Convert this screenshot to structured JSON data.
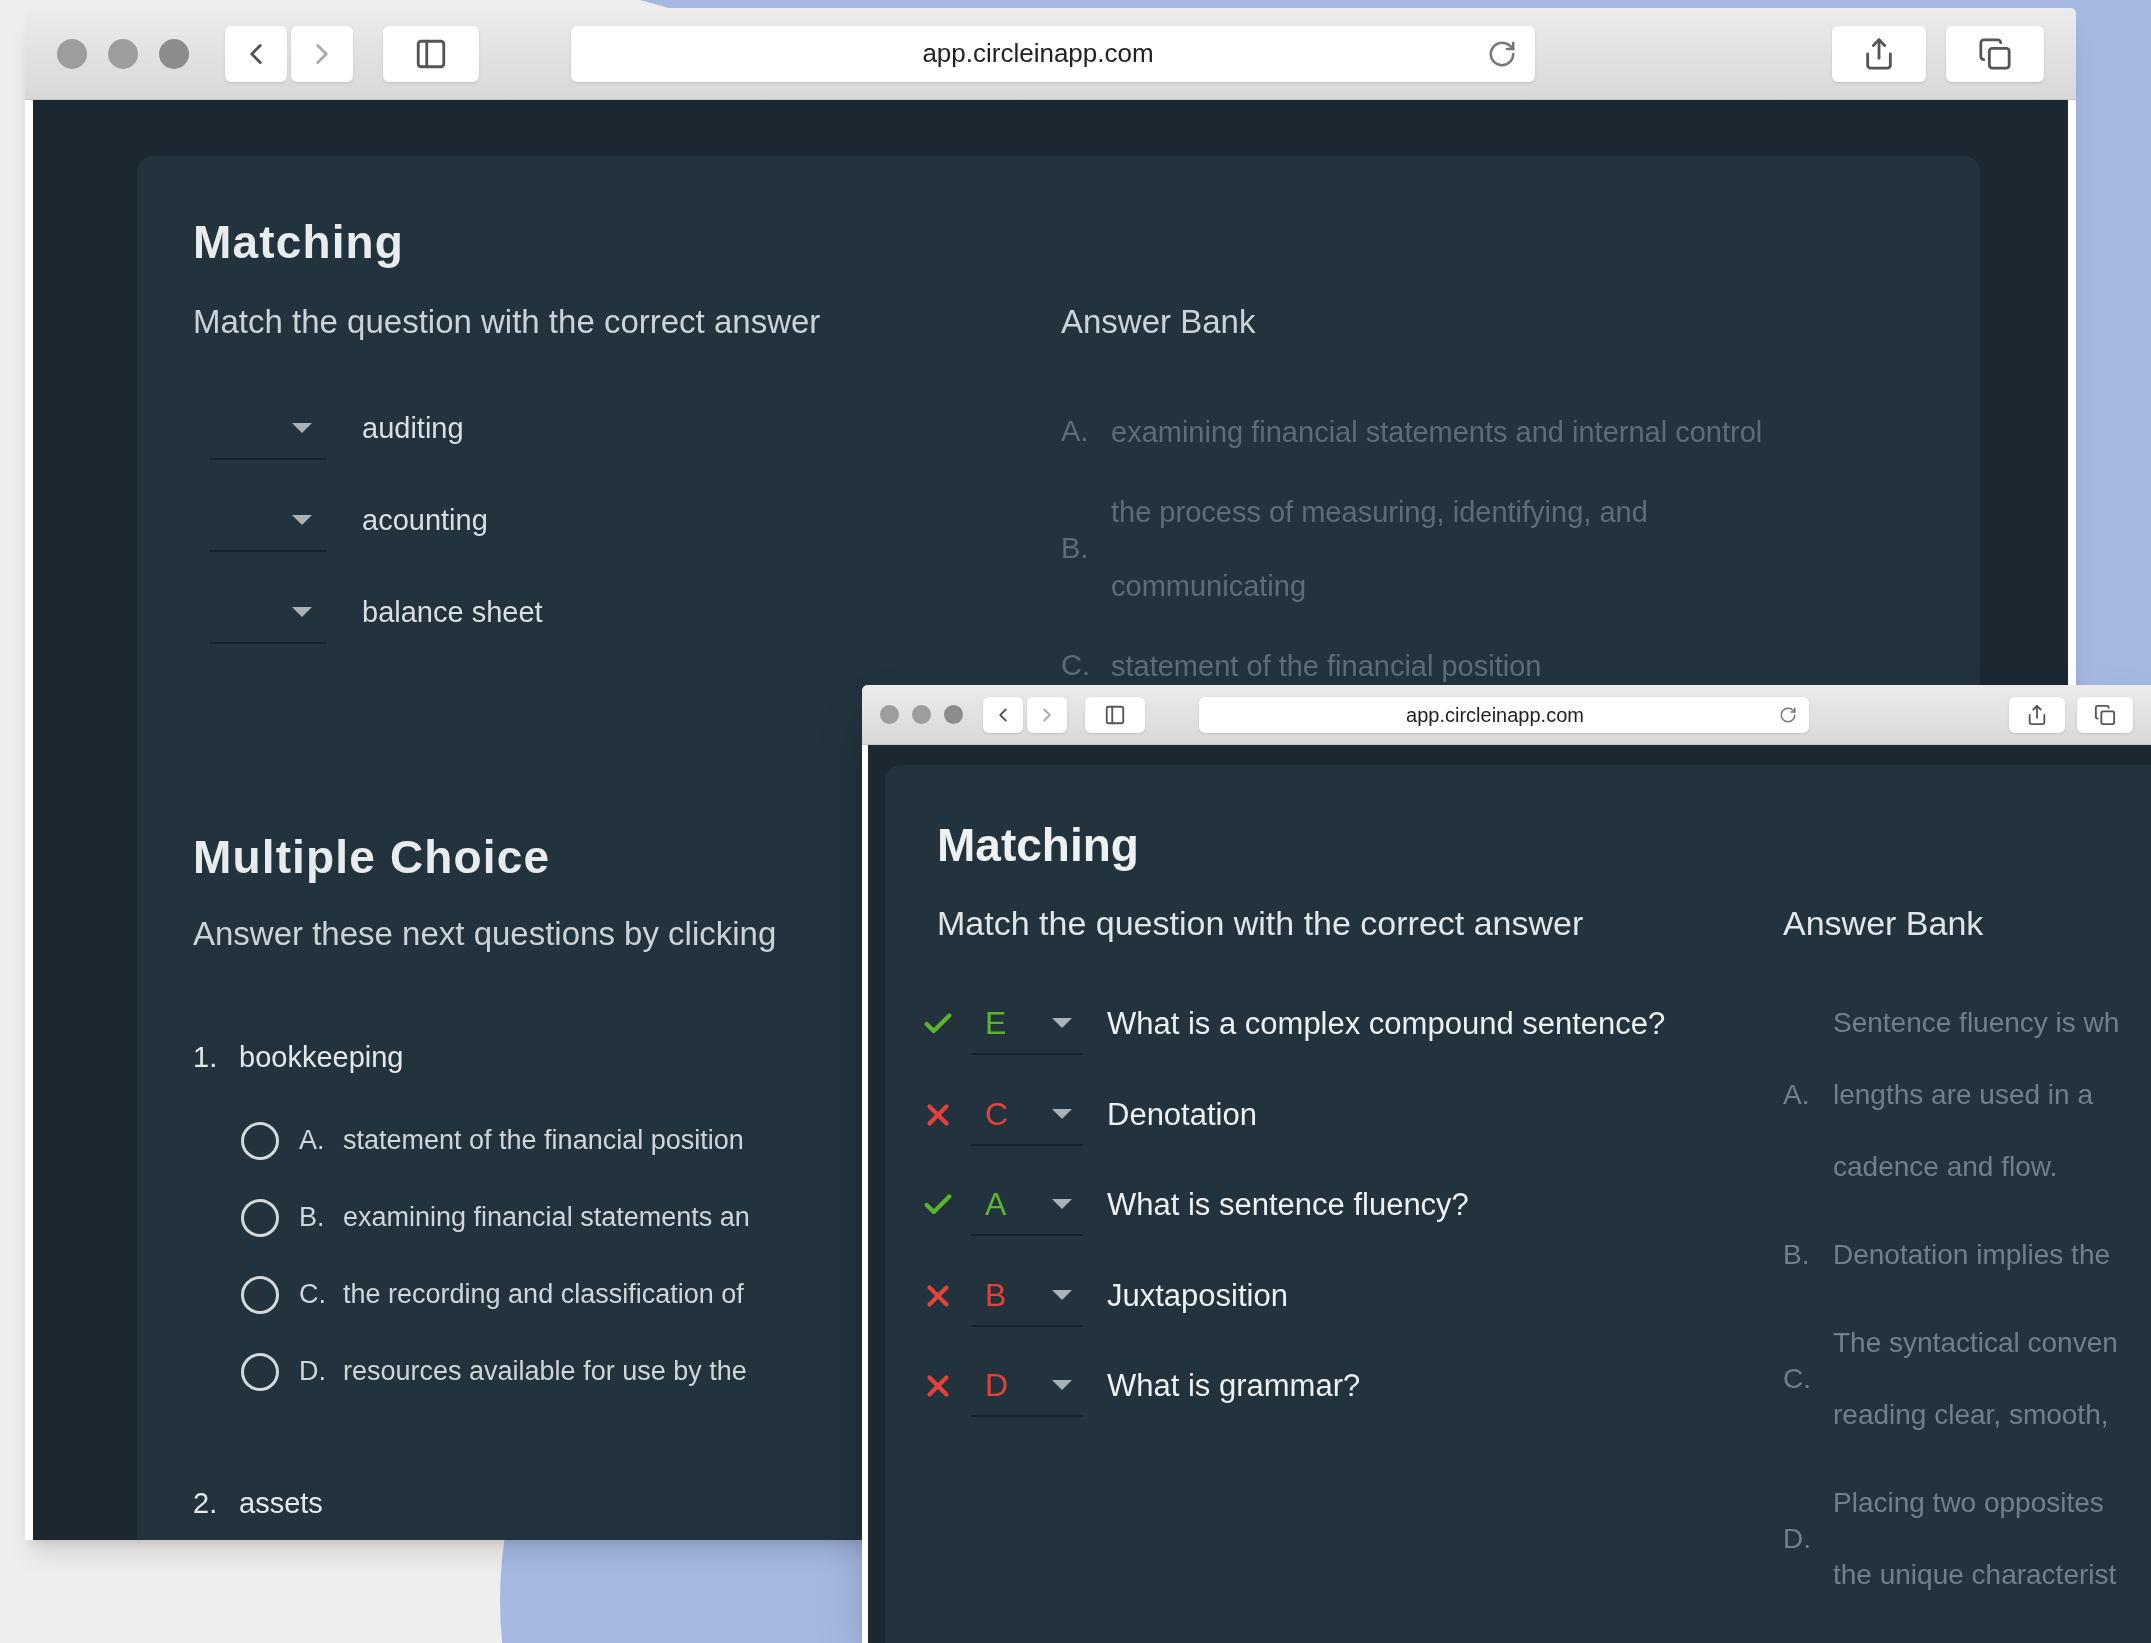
{
  "back_window": {
    "url": "app.circleinapp.com",
    "matching": {
      "title": "Matching",
      "instructions": "Match the question with the correct answer",
      "answer_bank_title": "Answer Bank",
      "questions": [
        {
          "text": "auditing"
        },
        {
          "text": "acounting"
        },
        {
          "text": "balance sheet"
        }
      ],
      "answer_bank": [
        {
          "letter": "A.",
          "lines": [
            "examining financial statements and internal control"
          ]
        },
        {
          "letter": "B.",
          "lines": [
            "the process of measuring, identifying, and",
            "communicating"
          ]
        },
        {
          "letter": "C.",
          "lines": [
            "statement of the financial position"
          ]
        }
      ]
    },
    "multiple_choice": {
      "title": "Multiple Choice",
      "instructions": "Answer these next questions by clicking",
      "questions": [
        {
          "number": "1.",
          "text": "bookkeeping",
          "options": [
            {
              "letter": "A.",
              "text": "statement of the financial position",
              "selected": false
            },
            {
              "letter": "B.",
              "text": "examining financial statements an",
              "selected": false
            },
            {
              "letter": "C.",
              "text": "the recording and classification of",
              "selected": false
            },
            {
              "letter": "D.",
              "text": "resources available for use by the",
              "selected": false
            }
          ]
        },
        {
          "number": "2.",
          "text": "assets"
        }
      ]
    }
  },
  "front_window": {
    "url": "app.circleinapp.com",
    "matching": {
      "title": "Matching",
      "instructions": "Match the question with the correct answer",
      "answer_bank_title": "Answer Bank",
      "questions": [
        {
          "correct": true,
          "answer": "E",
          "text": "What is a complex compound sentence?"
        },
        {
          "correct": false,
          "answer": "C",
          "text": "Denotation"
        },
        {
          "correct": true,
          "answer": "A",
          "text": "What is sentence fluency?"
        },
        {
          "correct": false,
          "answer": "B",
          "text": "Juxtaposition"
        },
        {
          "correct": false,
          "answer": "D",
          "text": "What is grammar?"
        }
      ],
      "answer_bank": [
        {
          "letter": "A.",
          "lines": [
            "Sentence fluency is wh",
            "lengths are used in a",
            "cadence and flow."
          ]
        },
        {
          "letter": "B.",
          "lines": [
            "Denotation implies the"
          ]
        },
        {
          "letter": "C.",
          "lines": [
            "The syntactical conven",
            "reading clear, smooth,"
          ]
        },
        {
          "letter": "D.",
          "lines": [
            "Placing two opposites",
            "the unique characterist"
          ]
        }
      ]
    }
  }
}
